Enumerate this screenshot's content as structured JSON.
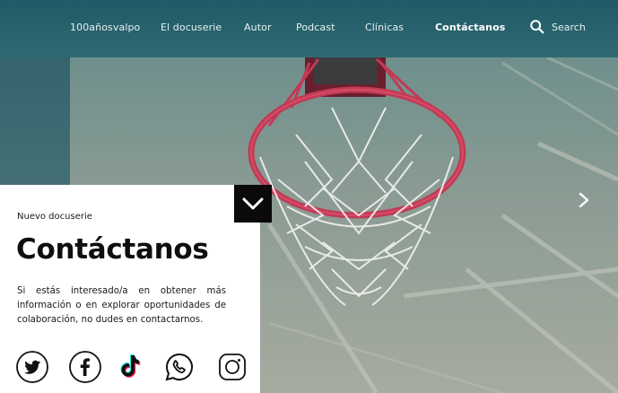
{
  "nav": {
    "items": [
      {
        "label": "100añosvalpo",
        "active": false
      },
      {
        "label": "El docuserie",
        "active": false
      },
      {
        "label": "Autor",
        "active": false
      },
      {
        "label": "Podcast",
        "active": false
      },
      {
        "label": "Clínicas",
        "active": false
      },
      {
        "label": "Contáctanos",
        "active": true
      }
    ],
    "search_label": "Search",
    "search_icon": "search-icon"
  },
  "hero": {
    "image": "basketball-hoop-net",
    "next_icon": "chevron-right-icon"
  },
  "panel": {
    "toggle_icon": "chevron-down-icon",
    "eyebrow": "Nuevo docuserie",
    "title": "Contáctanos",
    "body": "Si estás interesado/a en obtener más información o en explorar oportunidades de colaboración, no dudes en contactarnos.",
    "socials": [
      "twitter-icon",
      "facebook-icon",
      "tiktok-icon",
      "whatsapp-icon",
      "instagram-icon"
    ]
  },
  "colors": {
    "nav_bg": "#1f5a66",
    "panel_bg": "#ffffff",
    "toggle_bg": "#0a0a0a",
    "rim": "#c23a55",
    "net": "#e9e9e9"
  }
}
